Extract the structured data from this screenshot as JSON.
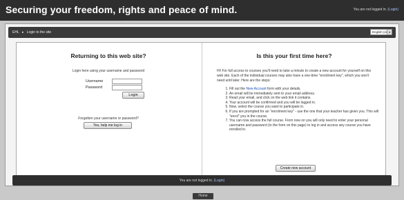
{
  "header": {
    "site_title": "Securing your freedom, rights and peace of mind.",
    "not_logged_text": "You are not logged in.",
    "login_link": "(Login)"
  },
  "navbar": {
    "crumb_home": "EHL",
    "crumb_separator": "▸",
    "crumb_current": "Login to the site",
    "language": "English (en)"
  },
  "login": {
    "heading": "Returning to this web site?",
    "description": "Login here using your username and password",
    "username_label": "Username",
    "password_label": "Password",
    "login_button": "Login",
    "forgot_text": "Forgotten your username or password?",
    "forgot_button": "Yes, help me log in"
  },
  "signup": {
    "heading": "Is this your first time here?",
    "intro_1": "Hi! For full access to courses you'll need to take a minute to create a new account for yourself on this web site. Each of the individual courses may also have a one-time \"enrolment key\", which you won't need until later. Here are the steps:",
    "steps": [
      {
        "pre": "Fill out the ",
        "link": "New Account",
        "post": " form with your details."
      },
      {
        "pre": "An email will be immediately sent to your email address.",
        "link": "",
        "post": ""
      },
      {
        "pre": "Read your email, and click on the web link it contains.",
        "link": "",
        "post": ""
      },
      {
        "pre": "Your account will be confirmed and you will be logged in.",
        "link": "",
        "post": ""
      },
      {
        "pre": "Now, select the course you want to participate in.",
        "link": "",
        "post": ""
      },
      {
        "pre": "If you are prompted for an \"enrolment key\" - use the one that your teacher has given you. This will \"enrol\" you in the course.",
        "link": "",
        "post": ""
      },
      {
        "pre": "You can now access the full course. From now on you will only need to enter your personal username and password (in the form on this page) to log in and access any course you have enrolled in.",
        "link": "",
        "post": ""
      }
    ],
    "create_button": "Create new account"
  },
  "footer": {
    "not_logged_text": "You are not logged in.",
    "login_link": "(Login)",
    "home_button": "Home"
  }
}
